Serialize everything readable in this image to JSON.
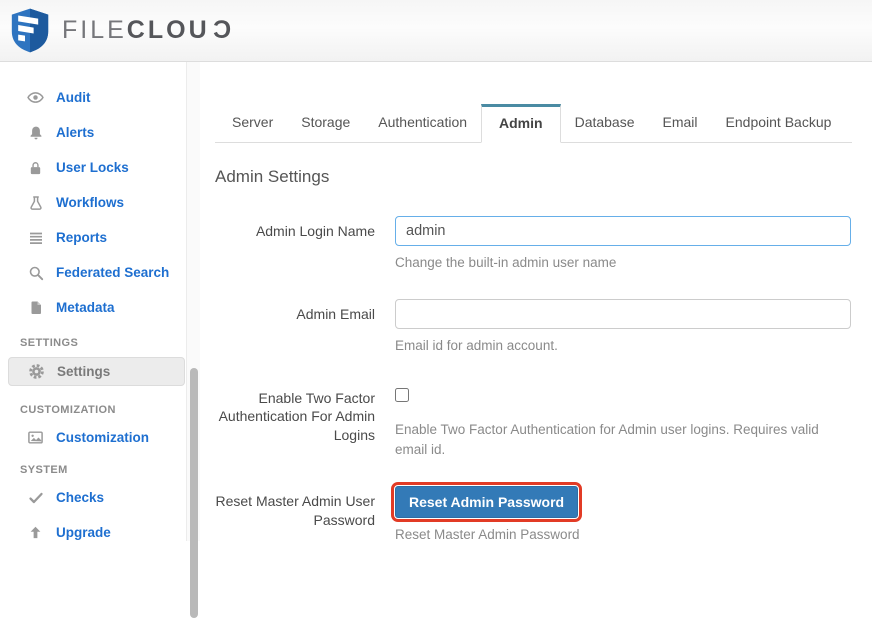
{
  "brand": {
    "file": "FILE",
    "clou": "CLOU",
    "reversed_c": "C",
    "shield_blue": "#2e74c0",
    "shield_dark_blue": "#1d5a9e"
  },
  "sidebar": {
    "items": [
      {
        "label": "Audit",
        "icon": "eye-icon"
      },
      {
        "label": "Alerts",
        "icon": "bell-icon"
      },
      {
        "label": "User Locks",
        "icon": "lock-icon"
      },
      {
        "label": "Workflows",
        "icon": "flask-icon"
      },
      {
        "label": "Reports",
        "icon": "list-icon"
      },
      {
        "label": "Federated Search",
        "icon": "search-icon"
      },
      {
        "label": "Metadata",
        "icon": "document-icon"
      },
      {
        "label": "Settings",
        "icon": "gear-icon",
        "selected": true
      },
      {
        "label": "Customization",
        "icon": "image-icon"
      },
      {
        "label": "Checks",
        "icon": "check-icon"
      },
      {
        "label": "Upgrade",
        "icon": "up-arrow-icon"
      }
    ],
    "sections": {
      "settings": "SETTINGS",
      "customization": "CUSTOMIZATION",
      "system": "SYSTEM"
    },
    "link_color": "#1e6fd0"
  },
  "tabs": [
    {
      "label": "Server"
    },
    {
      "label": "Storage"
    },
    {
      "label": "Authentication"
    },
    {
      "label": "Admin",
      "active": true
    },
    {
      "label": "Database"
    },
    {
      "label": "Email"
    },
    {
      "label": "Endpoint Backup"
    }
  ],
  "page": {
    "title": "Admin Settings"
  },
  "form": {
    "rows": [
      {
        "label": "Admin Login Name",
        "value": "admin",
        "help": "Change the built-in admin user name"
      },
      {
        "label": "Admin Email",
        "value": "",
        "help": "Email id for admin account."
      },
      {
        "label": "Enable Two Factor Authentication For Admin Logins",
        "checked": false,
        "help": "Enable Two Factor Authentication for Admin user logins. Requires valid email id."
      },
      {
        "label": "Reset Master Admin User Password",
        "button": "Reset Admin Password",
        "help": "Reset Master Admin Password"
      }
    ]
  },
  "colors": {
    "active_tab_accent": "#4a8ba3",
    "button_blue": "#337ab7",
    "annotation_red": "#e23b25",
    "focus_border_blue": "#66afe9",
    "sidebar_link_blue": "#1e6fd0"
  }
}
